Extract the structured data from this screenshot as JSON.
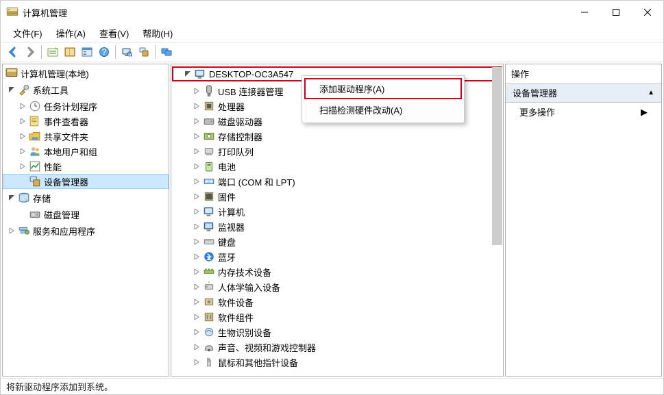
{
  "window": {
    "title": "计算机管理"
  },
  "menu": [
    {
      "label": "文件(F)"
    },
    {
      "label": "操作(A)"
    },
    {
      "label": "查看(V)"
    },
    {
      "label": "帮助(H)"
    }
  ],
  "toolbar": [
    {
      "name": "nav-back-icon"
    },
    {
      "name": "nav-forward-icon"
    },
    {
      "sep": true
    },
    {
      "name": "up-level-icon"
    },
    {
      "name": "show-hide-tree-icon"
    },
    {
      "name": "properties-sheet-icon"
    },
    {
      "name": "help-icon"
    },
    {
      "sep": true
    },
    {
      "name": "scan-hardware-icon"
    },
    {
      "name": "devices-icon"
    },
    {
      "sep": true
    },
    {
      "name": "monitors-icon"
    }
  ],
  "left_tree": {
    "root": "计算机管理(本地)",
    "nodes": [
      {
        "label": "系统工具",
        "expanded": true,
        "children": [
          {
            "label": "任务计划程序",
            "expandable": true
          },
          {
            "label": "事件查看器",
            "expandable": true
          },
          {
            "label": "共享文件夹",
            "expandable": true
          },
          {
            "label": "本地用户和组",
            "expandable": true
          },
          {
            "label": "性能",
            "expandable": true
          },
          {
            "label": "设备管理器",
            "selected": true
          }
        ]
      },
      {
        "label": "存储",
        "expanded": true,
        "children": [
          {
            "label": "磁盘管理"
          }
        ]
      },
      {
        "label": "服务和应用程序",
        "expandable": true
      }
    ]
  },
  "center_tree": {
    "root": "DESKTOP-OC3A547",
    "items": [
      "USB 连接器管理",
      "处理器",
      "磁盘驱动器",
      "存储控制器",
      "打印队列",
      "电池",
      "端口 (COM 和 LPT)",
      "固件",
      "计算机",
      "监视器",
      "键盘",
      "蓝牙",
      "内存技术设备",
      "人体学输入设备",
      "软件设备",
      "软件组件",
      "生物识别设备",
      "声音、视频和游戏控制器",
      "鼠标和其他指针设备"
    ]
  },
  "context_menu": {
    "items": [
      {
        "label": "添加驱动程序(A)",
        "highlight": true
      },
      {
        "label": "扫描检测硬件改动(A)"
      }
    ]
  },
  "actions_panel": {
    "header": "操作",
    "section": "设备管理器",
    "more_actions": "更多操作"
  },
  "statusbar": {
    "text": "将新驱动程序添加到系统。"
  }
}
